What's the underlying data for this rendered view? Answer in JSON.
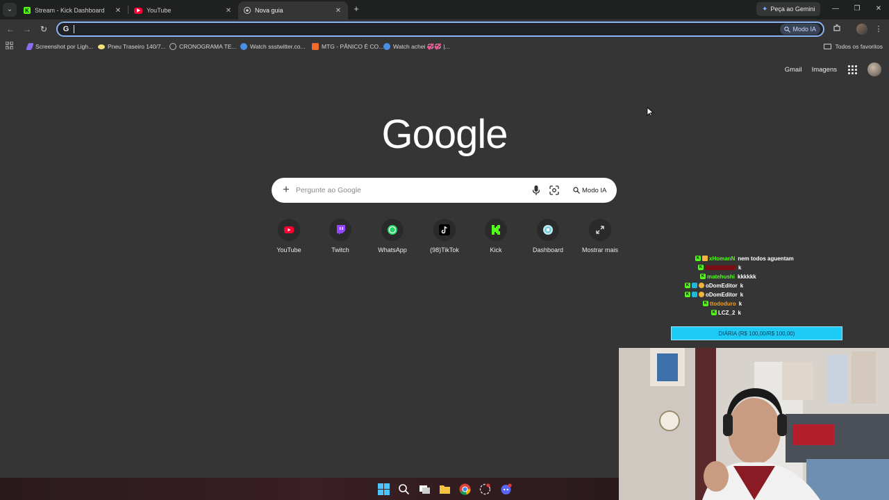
{
  "tabs": [
    {
      "title": "Stream - Kick Dashboard",
      "icon": "kick-icon",
      "active": false
    },
    {
      "title": "YouTube",
      "icon": "youtube-icon",
      "active": false
    },
    {
      "title": "Nova guia",
      "icon": "chrome-icon",
      "active": true
    }
  ],
  "window": {
    "gemini_label": "Peça ao Gemini",
    "minimize": "—",
    "restore": "❐",
    "close": "✕"
  },
  "toolbar": {
    "omnibox_value": "",
    "modo_ia_label": "Modo IA"
  },
  "bookmarks": {
    "items": [
      {
        "label": "Screenshot por Ligh...",
        "icon": "lightshot-icon",
        "color": "#8c6df0"
      },
      {
        "label": "Pneu Traseiro 140/7...",
        "icon": "mercadolivre-icon",
        "color": "#f2e27a"
      },
      {
        "label": "CRONOGRAMA TE...",
        "icon": "globe-icon",
        "color": "#bdbdbd"
      },
      {
        "label": "Watch ssstwitter.co...",
        "icon": "globe-icon",
        "color": "#4a8fe6"
      },
      {
        "label": "MTG - PÂNICO É CO...",
        "icon": "soundcloud-icon",
        "color": "#f26a2b"
      },
      {
        "label": "Watch achei 💞💞 |...",
        "icon": "globe-icon",
        "color": "#4a8fe6"
      }
    ],
    "all_label": "Todos os favoritos"
  },
  "page": {
    "gmail": "Gmail",
    "imagens": "Imagens",
    "logo": "Google",
    "search_placeholder": "Pergunte ao Google",
    "modo_ia": "Modo IA"
  },
  "shortcuts": [
    {
      "label": "YouTube",
      "icon": "youtube-icon",
      "color": "#ff0033"
    },
    {
      "label": "Twitch",
      "icon": "twitch-icon",
      "color": "#9146ff"
    },
    {
      "label": "WhatsApp",
      "icon": "whatsapp-icon",
      "color": "#25d366"
    },
    {
      "label": "(98)TikTok",
      "icon": "tiktok-icon",
      "color": "#000000"
    },
    {
      "label": "Kick",
      "icon": "kick-icon",
      "color": "#53fc18"
    },
    {
      "label": "Dashboard",
      "icon": "dashboard-icon",
      "color": "#5ec8d8"
    },
    {
      "label": "Mostrar mais",
      "icon": "expand-icon",
      "color": "#e8eaed"
    }
  ],
  "chat": [
    {
      "user": "xHomanN",
      "message": "nem todos aguentam",
      "user_color": "#53fc18",
      "badges": [
        "kick",
        "gold"
      ]
    },
    {
      "user": "",
      "message": "k",
      "user_color": "#b0141e",
      "badges": [
        "kick"
      ]
    },
    {
      "user": "matehushi",
      "message": "kkkkkk",
      "user_color": "#53fc18",
      "badges": [
        "kick"
      ]
    },
    {
      "user": "oDomEditor",
      "message": "k",
      "user_color": "#ffffff",
      "badges": [
        "kick",
        "mod",
        "gold"
      ]
    },
    {
      "user": "oDomEditor",
      "message": "k",
      "user_color": "#ffffff",
      "badges": [
        "kick",
        "mod",
        "gold"
      ]
    },
    {
      "user": "ttododuro",
      "message": "k",
      "user_color": "#f0a020",
      "badges": [
        "kick"
      ]
    },
    {
      "user": "LCZ_2",
      "message": "k",
      "user_color": "#ffffff",
      "badges": [
        "kick"
      ]
    }
  ],
  "goal": {
    "label": "DIÁRIA (R$ 100,00/R$ 100,00)",
    "progress": 1.0
  },
  "colors": {
    "accent": "#8ab4f8",
    "background": "#353535",
    "goal": "#1ecbf6"
  }
}
